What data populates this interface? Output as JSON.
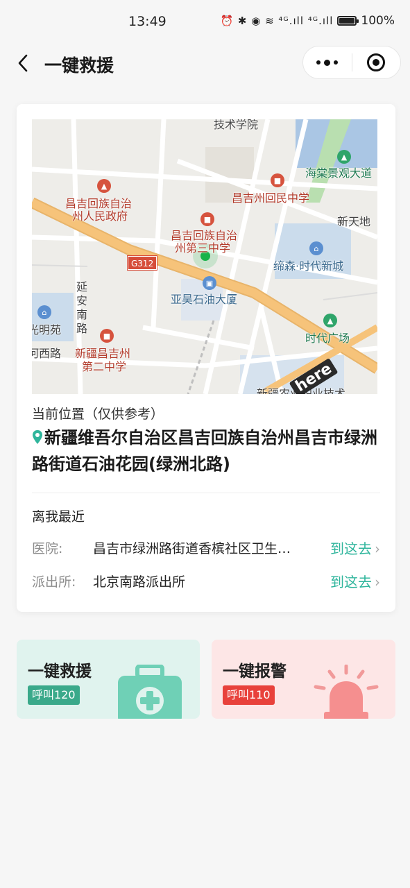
{
  "status_bar": {
    "time": "13:49",
    "signal_icons": "⏰ ✱ ◉ ≋ ⁴ᴳ.ıll ⁴ᴳ.ıll",
    "battery": "100%"
  },
  "nav": {
    "title": "一键救援"
  },
  "map": {
    "labels": {
      "school_top": "技术学院",
      "haitang": "海棠景观大道",
      "hui_middle": "昌吉州回民中学",
      "gov_1": "昌吉回族自治",
      "gov_2": "州人民政府",
      "third_1": "昌吉回族自治",
      "third_2": "州第三中学",
      "xintiandi": "新天地",
      "disen": "缔森·时代新城",
      "g312": "G312",
      "yahao": "亚昊石油大厦",
      "yanan": "延安南路",
      "mingyuan": "光明苑",
      "xilu": "河西路",
      "second_1": "新疆昌吉州",
      "second_2": "第二中学",
      "plaza": "时代广场",
      "bottom": "新疆农业职业技术",
      "here": "here"
    },
    "colors": {
      "main_road": "#f6c37a",
      "water": "#aac6e4",
      "green": "#b9dfb0",
      "current_location": "#19b34a"
    }
  },
  "location": {
    "label": "当前位置（仅供参考）",
    "address": "新疆维吾尔自治区昌吉回族自治州昌吉市绿洲路街道石油花园(绿洲北路)"
  },
  "nearest": {
    "title": "离我最近",
    "rows": [
      {
        "key": "医院:",
        "value": "昌吉市绿洲路街道香槟社区卫生服务站",
        "action": "到这去"
      },
      {
        "key": "派出所:",
        "value": "北京南路派出所",
        "action": "到这去"
      }
    ]
  },
  "actions": {
    "rescue": {
      "title": "一键救援",
      "tag": "呼叫120",
      "color": "#3aa98a"
    },
    "police": {
      "title": "一键报警",
      "tag": "呼叫110",
      "color": "#e8413b"
    }
  }
}
